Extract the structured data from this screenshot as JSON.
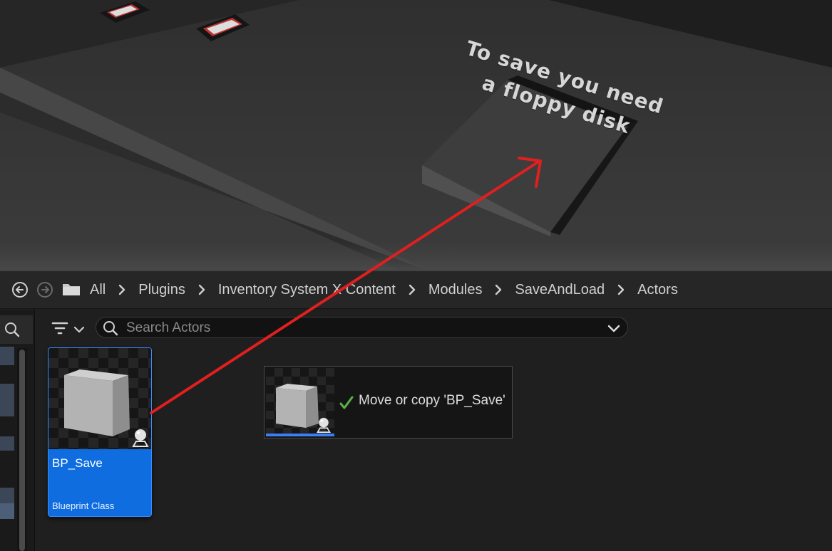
{
  "scene": {
    "caption_line1": "To save you need",
    "caption_line2": "a floppy disk"
  },
  "breadcrumb": {
    "back_icon": "circle-arrow-left-icon",
    "forward_icon": "circle-arrow-right-icon",
    "folder_icon": "folder-icon",
    "items": [
      "All",
      "Plugins",
      "Inventory System X Content",
      "Modules",
      "SaveAndLoad",
      "Actors"
    ],
    "separator_icon": "chevron-right-icon"
  },
  "toolbar": {
    "filter_icon": "filter-icon",
    "search_placeholder": "Search Actors",
    "search_value": "",
    "dropdown_icon": "chevron-down-icon"
  },
  "asset": {
    "name": "BP_Save",
    "type": "Blueprint Class",
    "selected": true,
    "icon": "actor-class-icon"
  },
  "drag_tooltip": {
    "message": "Move or copy 'BP_Save'",
    "status_icon": "checkmark-icon"
  },
  "colors": {
    "selection": "#0f6ddf",
    "accent_border": "#3b8cff",
    "annotation_arrow": "#e01f1f",
    "check": "#5ab24a"
  }
}
